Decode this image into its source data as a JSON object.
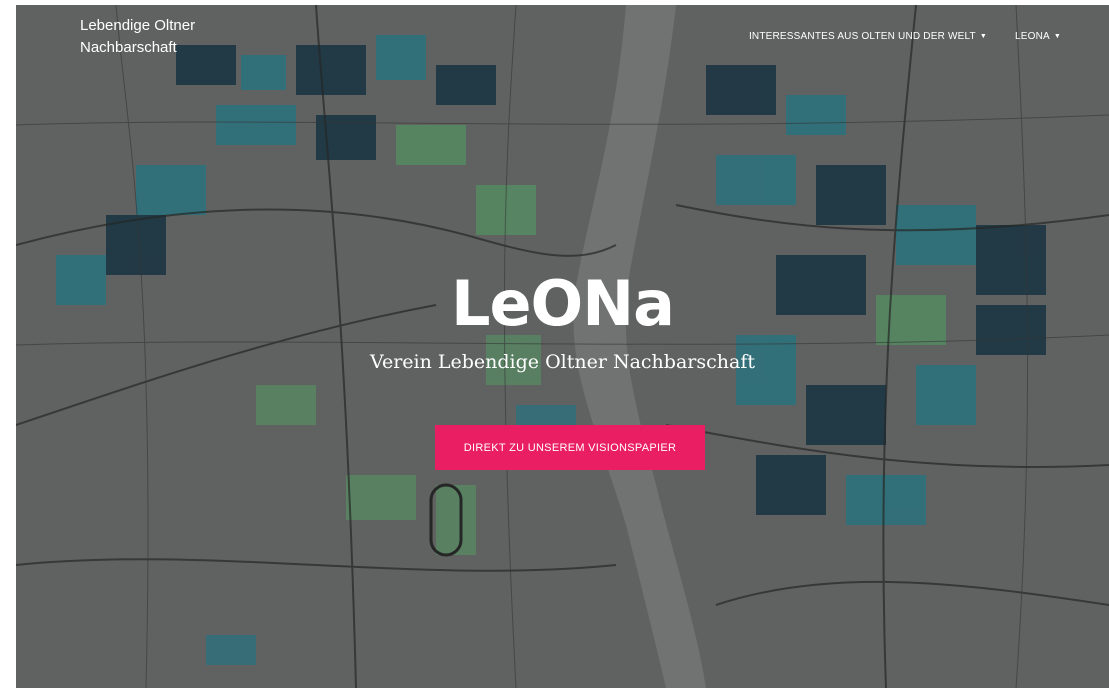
{
  "brand": {
    "line1": "Lebendige Oltner",
    "line2": "Nachbarschaft"
  },
  "nav": {
    "items": [
      {
        "label": "INTERESSANTES AUS OLTEN UND DER WELT",
        "icon": "caret-down-icon"
      },
      {
        "label": "LEONA",
        "icon": "caret-down-icon"
      }
    ]
  },
  "hero": {
    "title": "LeONa",
    "subtitle": "Verein Lebendige Oltner Nachbarschaft",
    "cta_label": "DIREKT ZU UNSEREM VISIONSPAPIER"
  },
  "colors": {
    "accent": "#e91e63",
    "map_base": "#6a6d6b",
    "block_dark": "#1b3a4a",
    "block_teal": "#2f7f8c",
    "block_green": "#5f9a6e"
  }
}
